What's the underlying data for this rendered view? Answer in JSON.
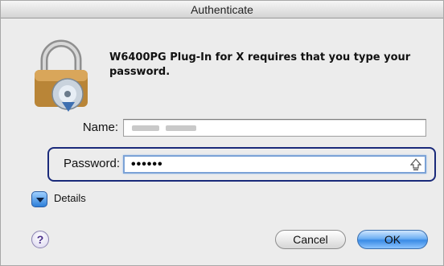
{
  "window": {
    "title": "Authenticate"
  },
  "icons": {
    "lock": "lock-disc-icon",
    "caps_lock": "caps-lock-icon",
    "disclosure": "disclosure-triangle-icon",
    "help": "help-icon"
  },
  "message": "W6400PG Plug-In for X requires that you type your password.",
  "name_field": {
    "label": "Name:",
    "value": ""
  },
  "password_field": {
    "label": "Password:",
    "value": "••••••"
  },
  "details": {
    "label": "Details"
  },
  "help": {
    "label": "?"
  },
  "buttons": {
    "cancel": "Cancel",
    "ok": "OK"
  },
  "colors": {
    "highlight_border": "#1a2a7a",
    "default_button": "#3a8be6",
    "focus_ring": "#7ba2d6"
  }
}
